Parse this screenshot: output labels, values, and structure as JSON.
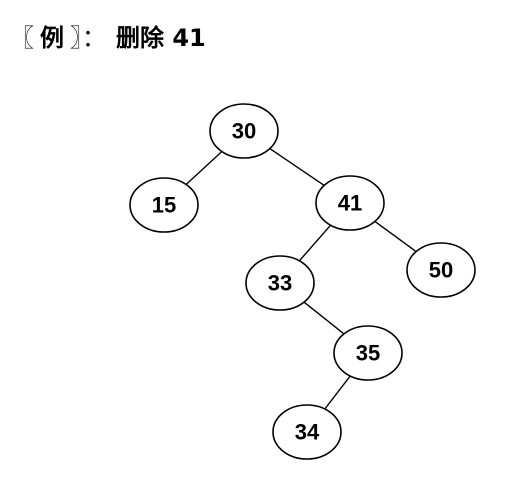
{
  "title": {
    "bracket_open": "〖",
    "label": "例",
    "bracket_close": "〗",
    "colon": "：",
    "action": "删除 41"
  },
  "tree": {
    "nodes": [
      {
        "id": "n30",
        "label": "30"
      },
      {
        "id": "n15",
        "label": "15"
      },
      {
        "id": "n41",
        "label": "41"
      },
      {
        "id": "n33",
        "label": "33"
      },
      {
        "id": "n50",
        "label": "50"
      },
      {
        "id": "n35",
        "label": "35"
      },
      {
        "id": "n34",
        "label": "34"
      }
    ],
    "edges": [
      {
        "from": "n30",
        "to": "n15"
      },
      {
        "from": "n30",
        "to": "n41"
      },
      {
        "from": "n41",
        "to": "n33"
      },
      {
        "from": "n41",
        "to": "n50"
      },
      {
        "from": "n33",
        "to": "n35"
      },
      {
        "from": "n35",
        "to": "n34"
      }
    ]
  }
}
